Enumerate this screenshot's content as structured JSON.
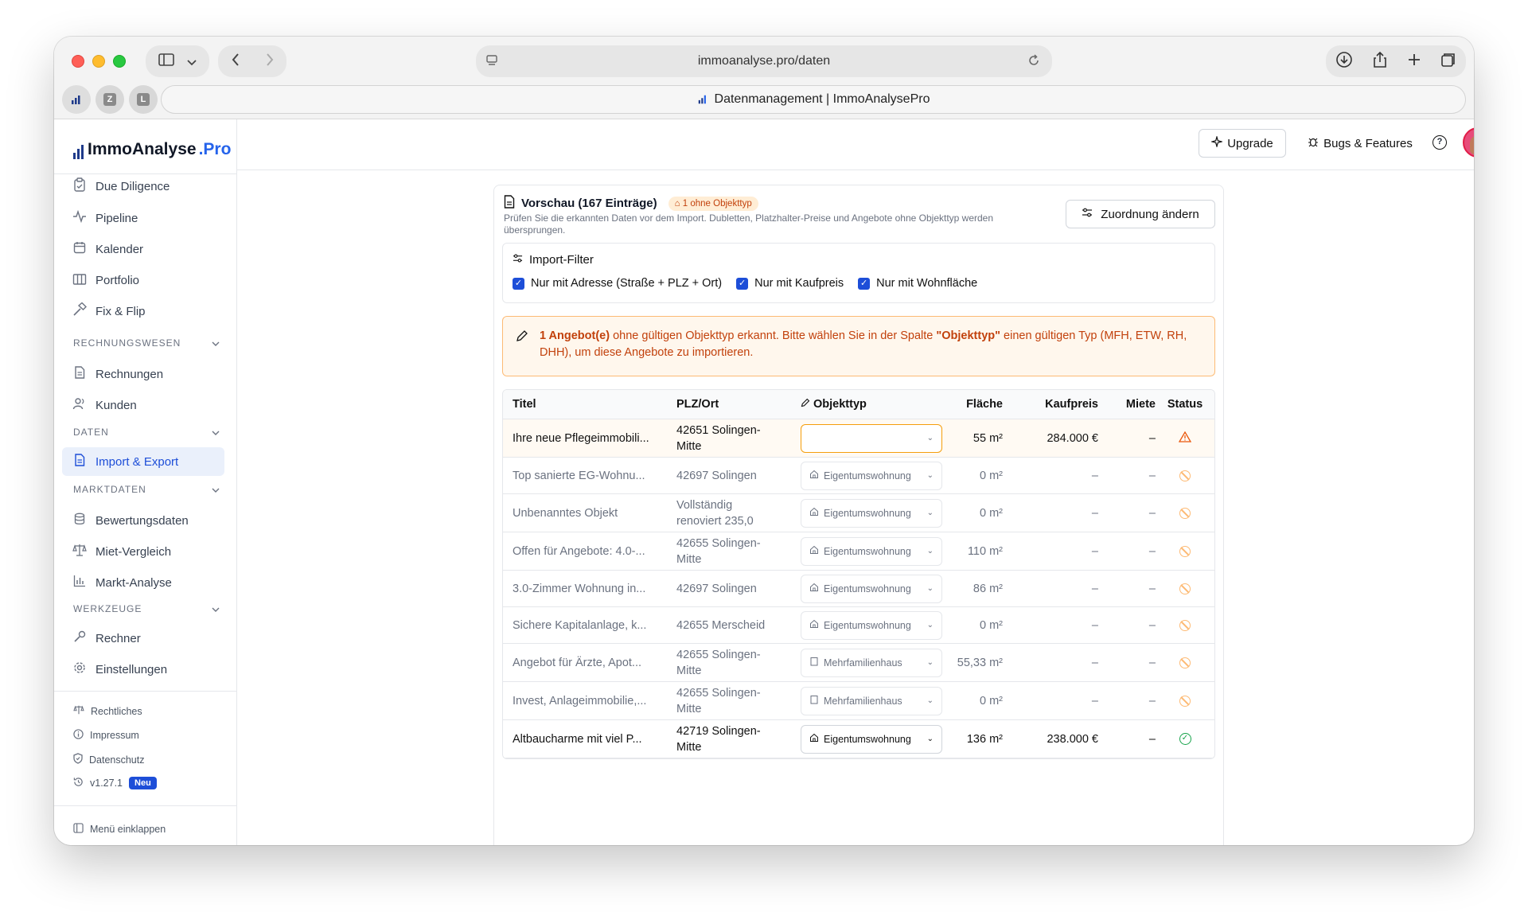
{
  "browser": {
    "url": "immoanalyse.pro/daten",
    "tab_title": "Datenmanagement | ImmoAnalysePro",
    "pinned_tabs": [
      "Z",
      "L"
    ]
  },
  "sidebar": {
    "logo_main": "ImmoAnalyse",
    "logo_accent": ".Pro",
    "items": [
      {
        "label": "Due Diligence",
        "icon": "clipboard-check-icon"
      },
      {
        "label": "Pipeline",
        "icon": "activity-icon"
      },
      {
        "label": "Kalender",
        "icon": "calendar-icon"
      },
      {
        "label": "Portfolio",
        "icon": "building-icon"
      },
      {
        "label": "Fix & Flip",
        "icon": "hammer-icon"
      }
    ],
    "sections": {
      "rechnungswesen": {
        "title": "RECHNUNGSWESEN",
        "items": [
          "Rechnungen",
          "Kunden"
        ]
      },
      "daten": {
        "title": "DATEN",
        "items": [
          "Import & Export"
        ]
      },
      "marktdaten": {
        "title": "MARKTDATEN",
        "items": [
          "Bewertungsdaten",
          "Miet-Vergleich",
          "Markt-Analyse"
        ]
      },
      "werkzeuge": {
        "title": "WERKZEUGE",
        "items": [
          "Rechner",
          "Einstellungen"
        ]
      }
    },
    "footer": {
      "rechtliches": "Rechtliches",
      "impressum": "Impressum",
      "datenschutz": "Datenschutz",
      "version": "v1.27.1",
      "version_badge": "Neu",
      "collapse": "Menü einklappen"
    }
  },
  "topbar": {
    "upgrade": "Upgrade",
    "bugs": "Bugs & Features",
    "help": "?"
  },
  "preview": {
    "title": "Vorschau (167 Einträge)",
    "warn_chip": "1 ohne Objekttyp",
    "subtitle": "Prüfen Sie die erkannten Daten vor dem Import. Dubletten, Platzhalter-Preise und Angebote ohne Objekttyp werden übersprungen.",
    "mapping_button": "Zuordnung ändern",
    "filter": {
      "title": "Import-Filter",
      "options": [
        {
          "label": "Nur mit Adresse (Straße + PLZ + Ort)",
          "checked": true
        },
        {
          "label": "Nur mit Kaufpreis",
          "checked": true
        },
        {
          "label": "Nur mit Wohnfläche",
          "checked": true
        }
      ]
    },
    "alert": {
      "bold": "1 Angebot(e)",
      "text_1": " ohne gültigen Objekttyp erkannt. Bitte wählen Sie in der Spalte ",
      "bold_2": "\"Objekttyp\"",
      "text_2": " einen gültigen Typ (MFH, ETW, RH, DHH), um diese Angebote zu importieren."
    }
  },
  "table": {
    "headers": {
      "title": "Titel",
      "plz": "PLZ/Ort",
      "typ": "Objekttyp",
      "flaeche": "Fläche",
      "kaufpreis": "Kaufpreis",
      "miete": "Miete",
      "status": "Status"
    },
    "rows": [
      {
        "title": "Ihre neue Pflegeimmobili...",
        "plz": "42651 Solingen-Mitte",
        "typ": "",
        "flaeche": "55 m²",
        "kaufpreis": "284.000 €",
        "miete": "–",
        "status": "warning",
        "state": "highlight"
      },
      {
        "title": "Top sanierte EG-Wohnu...",
        "plz": "42697 Solingen",
        "typ": "Eigentumswohnung",
        "flaeche": "0 m²",
        "kaufpreis": "–",
        "miete": "–",
        "status": "skipped",
        "state": "muted"
      },
      {
        "title": "Unbenanntes Objekt",
        "plz": "Vollständig renoviert 235,0",
        "typ": "Eigentumswohnung",
        "flaeche": "0 m²",
        "kaufpreis": "–",
        "miete": "–",
        "status": "skipped",
        "state": "muted"
      },
      {
        "title": "Offen für Angebote: 4.0-...",
        "plz": "42655 Solingen-Mitte",
        "typ": "Eigentumswohnung",
        "flaeche": "110 m²",
        "kaufpreis": "–",
        "miete": "–",
        "status": "skipped",
        "state": "muted"
      },
      {
        "title": "3.0-Zimmer Wohnung in...",
        "plz": "42697 Solingen",
        "typ": "Eigentumswohnung",
        "flaeche": "86 m²",
        "kaufpreis": "–",
        "miete": "–",
        "status": "skipped",
        "state": "muted"
      },
      {
        "title": "Sichere Kapitalanlage, k...",
        "plz": "42655 Merscheid",
        "typ": "Eigentumswohnung",
        "flaeche": "0 m²",
        "kaufpreis": "–",
        "miete": "–",
        "status": "skipped",
        "state": "muted"
      },
      {
        "title": "Angebot für Ärzte, Apot...",
        "plz": "42655 Solingen-Mitte",
        "typ": "Mehrfamilienhaus",
        "flaeche": "55,33 m²",
        "kaufpreis": "–",
        "miete": "–",
        "status": "skipped",
        "state": "muted"
      },
      {
        "title": "Invest, Anlageimmobilie,...",
        "plz": "42655 Solingen-Mitte",
        "typ": "Mehrfamilienhaus",
        "flaeche": "0 m²",
        "kaufpreis": "–",
        "miete": "–",
        "status": "skipped",
        "state": "muted"
      },
      {
        "title": "Altbaucharme mit viel P...",
        "plz": "42719 Solingen-Mitte",
        "typ": "Eigentumswohnung",
        "flaeche": "136 m²",
        "kaufpreis": "238.000 €",
        "miete": "–",
        "status": "ok",
        "state": "normal"
      }
    ]
  },
  "colors": {
    "accent": "#1d4ed8",
    "warning": "#ea580c",
    "ok": "#16a34a"
  }
}
